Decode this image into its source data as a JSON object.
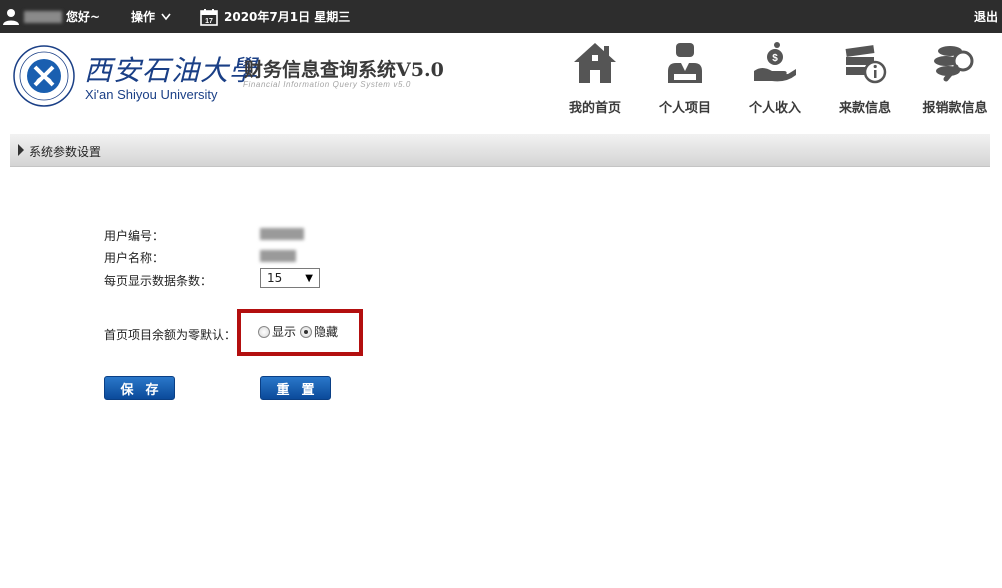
{
  "topbar": {
    "greeting": "您好~",
    "ops_label": "操作",
    "date": "2020年7月1日 星期三",
    "logout": "退出"
  },
  "header": {
    "university_cn": "西安石油大學",
    "university_en": "Xi'an Shiyou University",
    "system_title": "财务信息查询系统V5.0",
    "system_subtitle": "Financial Information Query System v5.0"
  },
  "nav": [
    {
      "label": "我的首页",
      "icon": "home-icon"
    },
    {
      "label": "个人项目",
      "icon": "person-icon"
    },
    {
      "label": "个人收入",
      "icon": "income-hand-icon"
    },
    {
      "label": "来款信息",
      "icon": "money-info-icon"
    },
    {
      "label": "报销款信息",
      "icon": "coin-search-icon"
    }
  ],
  "section": {
    "title": "系统参数设置"
  },
  "form": {
    "user_id_label": "用户编号：",
    "user_name_label": "用户名称：",
    "page_size_label": "每页显示数据条数：",
    "page_size_value": "15",
    "zero_balance_label": "首页项目余额为零默认：",
    "option_show": "显示",
    "option_hide": "隐藏",
    "selected_option": "隐藏"
  },
  "buttons": {
    "save": "保存",
    "reset": "重置"
  },
  "colors": {
    "topbar": "#2d2d2d",
    "button": "#0b4a9a",
    "highlight": "#b30f0f",
    "brand": "#1a3f86"
  }
}
